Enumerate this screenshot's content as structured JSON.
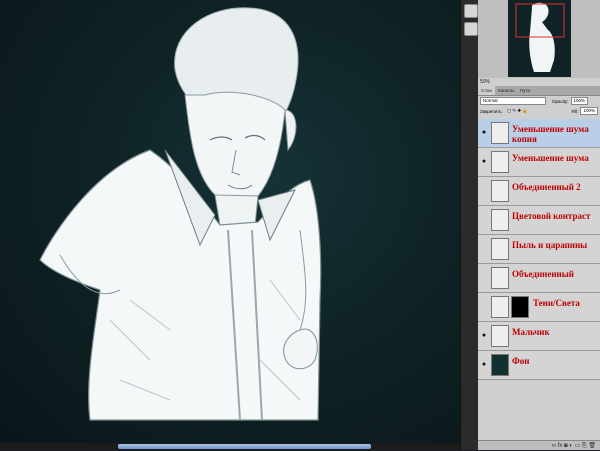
{
  "navigator": {
    "zoom": "50%"
  },
  "panel_tabs": [
    "Слои",
    "Каналы",
    "Пути"
  ],
  "layers_panel": {
    "blend_mode": "Normal",
    "opacity_label": "Opacity:",
    "opacity_value": "100%",
    "lock_label": "Закрепить:",
    "fill_label": "Fill:",
    "fill_value": "100%",
    "bottom_icons": "∞ fx ◙ ◐ ▭ ⎘ 🗑"
  },
  "layers": [
    {
      "name": "Уменьшение шума копия",
      "visible": true,
      "selected": true,
      "thumb": "light",
      "mask": false
    },
    {
      "name": "Уменьшение шума",
      "visible": true,
      "selected": false,
      "thumb": "light",
      "mask": false
    },
    {
      "name": "Объединенный 2",
      "visible": false,
      "selected": false,
      "thumb": "light",
      "mask": false
    },
    {
      "name": "Цветовой контраст",
      "visible": false,
      "selected": false,
      "thumb": "light",
      "mask": false
    },
    {
      "name": "Пыль и царапины",
      "visible": false,
      "selected": false,
      "thumb": "light",
      "mask": false
    },
    {
      "name": "Объединенный",
      "visible": false,
      "selected": false,
      "thumb": "light",
      "mask": false
    },
    {
      "name": "Тени/Света",
      "visible": false,
      "selected": false,
      "thumb": "light",
      "mask": true
    },
    {
      "name": "Мальчик",
      "visible": true,
      "selected": false,
      "thumb": "light",
      "mask": false
    },
    {
      "name": "Фон",
      "visible": true,
      "selected": false,
      "thumb": "dark",
      "mask": false
    }
  ],
  "colors": {
    "layer_name": "#c00000",
    "selection": "#b9cfe8",
    "canvas_bg": "#0f2326"
  }
}
